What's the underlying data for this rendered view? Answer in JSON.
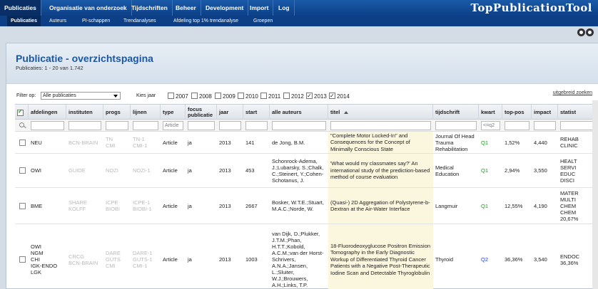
{
  "app": {
    "brand": "TopPublicationTool"
  },
  "nav": {
    "items": [
      "Publicaties",
      "Organisatie van onderzoek",
      "Tijdschriften",
      "Beheer",
      "Development",
      "Import",
      "Log"
    ],
    "active": "Publicaties"
  },
  "subnav": {
    "items": [
      "Publicaties",
      "Auteurs",
      "PI-schappen",
      "Trendanalyses",
      "Afdeling top 1% trendanalyse",
      "Groepen"
    ],
    "active": "Publicaties"
  },
  "page": {
    "title": "Publicatie - overzichtspagina",
    "count": "Publicaties: 1 - 20 van 1.742"
  },
  "filter": {
    "label": "Filter op:",
    "selected": "Alle publicaties",
    "year_label": "Kies jaar",
    "years": [
      {
        "year": "2007",
        "checked": false
      },
      {
        "year": "2008",
        "checked": false
      },
      {
        "year": "2009",
        "checked": false
      },
      {
        "year": "2010",
        "checked": false
      },
      {
        "year": "2011",
        "checked": false
      },
      {
        "year": "2012",
        "checked": false
      },
      {
        "year": "2013",
        "checked": true
      },
      {
        "year": "2014",
        "checked": true
      }
    ],
    "advanced": "uitgebreid zoeken"
  },
  "table": {
    "headers": [
      "afdelingen",
      "instituten",
      "progs",
      "lijnen",
      "type",
      "focus publicatie",
      "jaar",
      "start",
      "alle auteurs",
      "titel",
      "tijdschrift",
      "kwart",
      "top-pos",
      "impact",
      "statist"
    ],
    "filter_placeholders": {
      "type": "Article",
      "kwart": "<=q2"
    },
    "rows": [
      {
        "afdelingen": "NEU",
        "instituten": "BCN-BRAIN",
        "progs": "TN\nCMI",
        "lijnen": "TN-1\nCMI-1",
        "type": "Article",
        "focus": "ja",
        "jaar": "2013",
        "start": "141",
        "auteurs": "de Jong, B.M.",
        "titel": "\"Complete Motor Locked-In\" and Consequences for the Concept of Minimally Conscious State",
        "tijdschrift": "Journal Of Head Trauma Rehabilitation",
        "kwart": "Q1",
        "toppos": "1,52%",
        "impact": "4,440",
        "statist": "REHAB\nCLINIC"
      },
      {
        "afdelingen": "OWI",
        "instituten": "GUIDE",
        "progs": "NOZI",
        "lijnen": "NOZI-1",
        "type": "Article",
        "focus": "ja",
        "jaar": "2013",
        "start": "453",
        "auteurs": "Schonrock-Adema, J.;Lubarsky, S.;Chalk, C.;Steinert, Y.;Cohen-Schotanus, J.",
        "titel": "'What would my classmates say?' An international study of the prediction-based method of course evaluation",
        "tijdschrift": "Medical Education",
        "kwart": "Q1",
        "toppos": "2,94%",
        "impact": "3,550",
        "statist": "HEALT\nSERVI\nEDUC\nDISCI"
      },
      {
        "afdelingen": "BME",
        "instituten": "SHARE\nKOLFF",
        "progs": "ICPE\nBIOBI",
        "lijnen": "ICPE-1\nBIOBI-1",
        "type": "Article",
        "focus": "ja",
        "jaar": "2013",
        "start": "2667",
        "auteurs": "Bosker, W.T.E.;Stuart, M.A.C.;Norde, W.",
        "titel": "(Quasi-) 2D Aggregation of Polystyrene-b-Dextran at the Air-Water Interface",
        "tijdschrift": "Langmuir",
        "kwart": "Q1",
        "toppos": "12,55%",
        "impact": "4,190",
        "statist": "MATER\nMULTI\nCHEM\nCHEM\n20,67%"
      },
      {
        "afdelingen": "OWI\nNGM\nCHI\nIGK-ENDO\nLGK",
        "instituten": "CRCG\nBCN-BRAIN",
        "progs": "DARE\nGUTS\nCMI",
        "lijnen": "DARE-1\nGUTS-1\nCMI-1",
        "type": "Article",
        "focus": "ja",
        "jaar": "2013",
        "start": "1003",
        "auteurs": "van Dijk, D.;Plukker, J.T.M.;Phan, H.T.T.;Kobold, A.C.M.;van der Horst-Schrivers, A.N.A.;Jansen, L.;Sluiter, W.J.;Brouwers, A.H.;Links, T.P.",
        "titel": "18-Fluorodeoxyglucose Positron Emission Tomography in the Early Diagnostic Workup of Differentiated Thyroid Cancer Patients with a Negative Post-Therapeutic Iodine Scan and Detectable Thyroglobulin",
        "tijdschrift": "Thyroid",
        "kwart": "Q2",
        "toppos": "36,36%",
        "impact": "3,540",
        "statist": "ENDOC\n36,36%"
      }
    ]
  }
}
